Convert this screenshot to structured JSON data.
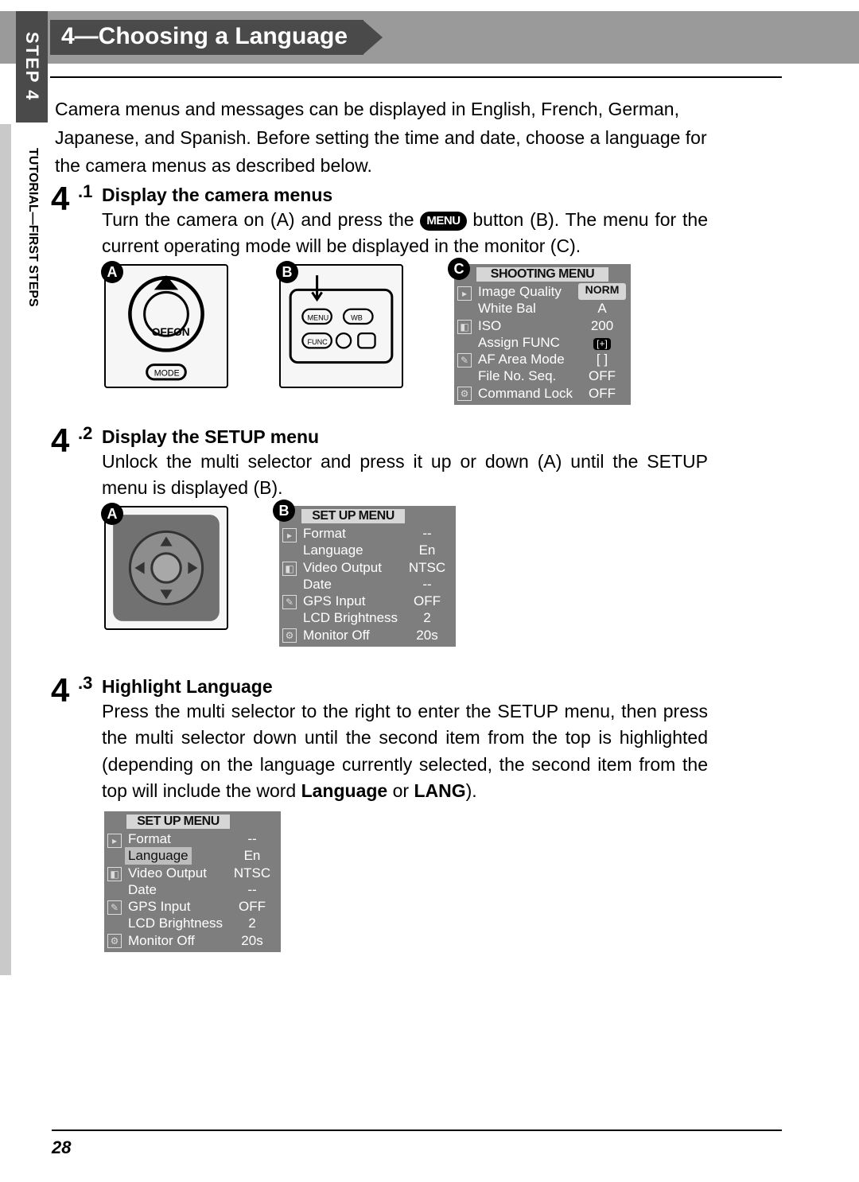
{
  "header": {
    "ribbon_title": "4—Choosing a Language",
    "step_label": "STEP 4",
    "side_label": "TUTORIAL—FIRST STEPS"
  },
  "intro": "Camera menus and messages can be displayed in English, French, German, Japanese, and Spanish.  Before setting the time and date, choose a language for the camera menus as described below.",
  "step41": {
    "num": "4",
    "sub": ".1",
    "title": "Display the camera menus",
    "body_a": "Turn the camera on (A) and press the ",
    "menu_label": "MENU",
    "body_b": " button (B).  The menu for the current operating mode will be displayed in the monitor (C)."
  },
  "step42": {
    "num": "4",
    "sub": ".2",
    "title": "Display the SETUP menu",
    "body": "Unlock the multi selector and press it up or down (A) until the SETUP menu is displayed (B)."
  },
  "step43": {
    "num": "4",
    "sub": ".3",
    "title": "Highlight Language",
    "body_a": "Press the multi selector to the right to enter the SETUP menu, then press the multi selector down until the second item from the top is highlighted (depending on the language currently selected, the second item from the top will include the word ",
    "bold1": "Language",
    "body_b": " or ",
    "bold2": "LANG",
    "body_c": ")."
  },
  "lcd_shooting": {
    "title": "SHOOTING MENU",
    "rows": [
      {
        "l": "Image Quality",
        "r": "NORM"
      },
      {
        "l": "White Bal",
        "r": "A"
      },
      {
        "l": "ISO",
        "r": "200"
      },
      {
        "l": "Assign FUNC",
        "r": "[+]"
      },
      {
        "l": "AF Area Mode",
        "r": "[ ]"
      },
      {
        "l": "File No. Seq.",
        "r": "OFF"
      },
      {
        "l": "Command Lock",
        "r": "OFF"
      }
    ]
  },
  "lcd_setup": {
    "title": "SET UP MENU",
    "rows": [
      {
        "l": "Format",
        "r": "--"
      },
      {
        "l": "Language",
        "r": "En"
      },
      {
        "l": "Video Output",
        "r": "NTSC"
      },
      {
        "l": "Date",
        "r": "--"
      },
      {
        "l": "GPS Input",
        "r": "OFF"
      },
      {
        "l": "LCD Brightness",
        "r": "2"
      },
      {
        "l": "Monitor Off",
        "r": "20s"
      }
    ]
  },
  "fig_letters": {
    "A": "A",
    "B": "B",
    "C": "C"
  },
  "page_number": "28"
}
